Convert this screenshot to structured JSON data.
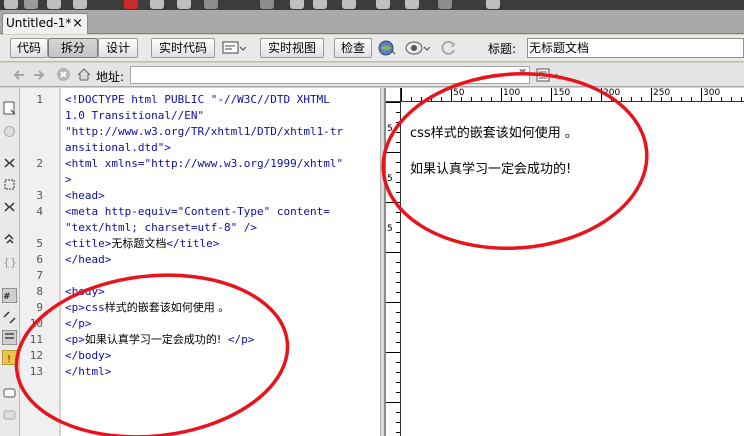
{
  "tab": {
    "title": "Untitled-1*",
    "close_glyph": "×"
  },
  "toolbar": {
    "code": "代码",
    "split": "拆分",
    "design": "设计",
    "live_code": "实时代码",
    "live_view": "实时视图",
    "inspect": "检查",
    "title_label": "标题:",
    "title_value": "无标题文档"
  },
  "address": {
    "label": "地址:",
    "value": ""
  },
  "code": {
    "lines": [
      {
        "num": "1",
        "text": "<!DOCTYPE html PUBLIC \"-//W3C//DTD XHTML"
      },
      {
        "num": "",
        "text": "1.0 Transitional//EN\""
      },
      {
        "num": "",
        "text": "\"http://www.w3.org/TR/xhtml1/DTD/xhtml1-tr"
      },
      {
        "num": "",
        "text": "ansitional.dtd\">"
      },
      {
        "num": "2",
        "text": "<html xmlns=\"http://www.w3.org/1999/xhtml\""
      },
      {
        "num": "",
        "text": ">"
      },
      {
        "num": "3",
        "text": "<head>"
      },
      {
        "num": "4",
        "text": "<meta http-equiv=\"Content-Type\" content="
      },
      {
        "num": "",
        "text": "\"text/html; charset=utf-8\" />"
      },
      {
        "num": "5",
        "text_a": "<title>",
        "text_zh": "无标题文档",
        "text_b": "</title>"
      },
      {
        "num": "6",
        "text": "</head>"
      },
      {
        "num": "7",
        "text": ""
      },
      {
        "num": "8",
        "text": "<body>"
      },
      {
        "num": "9",
        "text_a": "<p>css",
        "text_zh": "样式的嵌套该如何使用 。",
        "text_b": ""
      },
      {
        "num": "10",
        "text": "</p>"
      },
      {
        "num": "11",
        "text_a": "<p>",
        "text_zh": "如果认真学习一定会成功的!",
        "text_b": " </p>"
      },
      {
        "num": "12",
        "text": "</body>"
      },
      {
        "num": "13",
        "text": "</html>"
      }
    ]
  },
  "ruler": {
    "h_ticks": [
      "50",
      "100",
      "150",
      "200",
      "250",
      "300"
    ],
    "v_ticks": [
      "5",
      "5",
      "5"
    ]
  },
  "design_view": {
    "line1": "css样式的嵌套该如何使用 。",
    "line2": "如果认真学习一定会成功的!"
  },
  "colors": {
    "annotation": "#e8141c",
    "code_tag": "#0d0da6"
  }
}
